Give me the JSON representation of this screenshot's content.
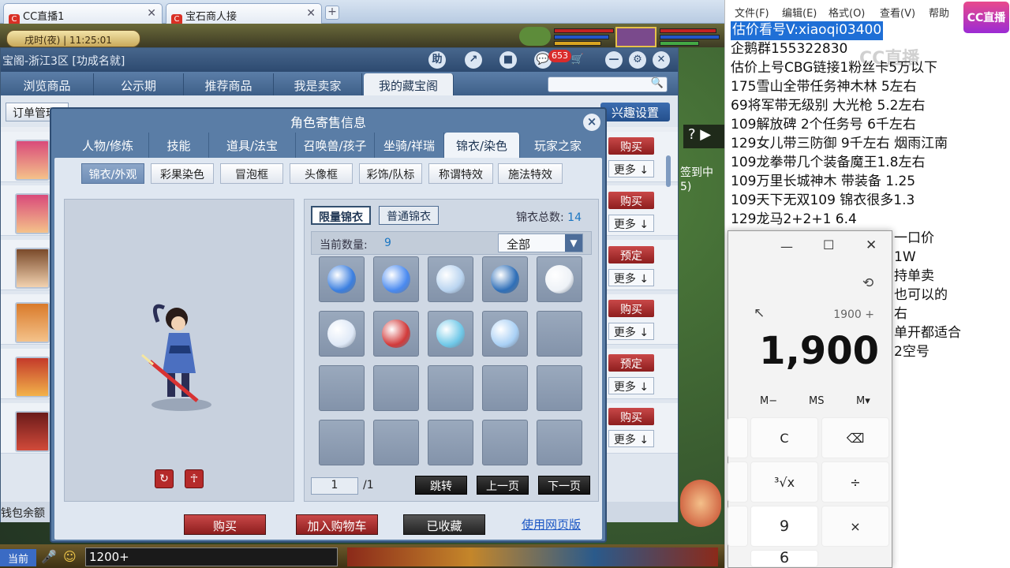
{
  "browser": {
    "tabs": [
      {
        "icon": "cc",
        "label": "CC直播1"
      },
      {
        "icon": "cc",
        "label": "宝石商人接"
      }
    ],
    "new_tab": "+"
  },
  "game": {
    "clock": "戌时(夜) | 11:25:01",
    "window": {
      "title": "宝阁-浙江3区 [功成名就]",
      "notify_count": "653",
      "header_buttons": [
        "助",
        "↗",
        "■",
        "💬",
        "🛒",
        "—",
        "⚙",
        "✕"
      ],
      "tabs": [
        "浏览商品",
        "公示期",
        "推荐商品",
        "我是卖家",
        "我的藏宝阁"
      ],
      "active_tab": 4,
      "sub_left": "订单管理",
      "sub_right": "兴趣设置",
      "side_text_1": "签到中",
      "side_text_2": "5)",
      "row_actions": [
        {
          "primary": "购买",
          "secondary": "更多"
        },
        {
          "primary": "购买",
          "secondary": "更多"
        },
        {
          "primary": "预定",
          "secondary": "更多"
        },
        {
          "primary": "购买",
          "secondary": "更多"
        },
        {
          "primary": "预定",
          "secondary": "更多"
        },
        {
          "primary": "购买",
          "secondary": "更多"
        }
      ],
      "wallet_label": "钱包余额"
    },
    "dialog": {
      "title": "角色寄售信息",
      "close": "×",
      "tabs": [
        "人物/修炼",
        "技能",
        "道具/法宝",
        "召唤兽/孩子",
        "坐骑/祥瑞",
        "锦衣/染色",
        "玩家之家"
      ],
      "active_tab": 5,
      "sub_tabs": [
        "锦衣/外观",
        "彩果染色",
        "冒泡框",
        "头像框",
        "彩饰/队标",
        "称谓特效",
        "施法特效"
      ],
      "active_sub_tab": 0,
      "list_tabs": [
        "限量锦衣",
        "普通锦衣"
      ],
      "active_list_tab": 0,
      "total_label": "锦衣总数:",
      "total_value": "14",
      "count_label": "当前数量:",
      "count_value": "9",
      "filter_value": "全部",
      "items": [
        "blue-swirl",
        "blue-wave",
        "silver-swirl",
        "blue-robe",
        "white-robe",
        "white-dress",
        "red-hair",
        "ice-beast",
        "crystal-wing"
      ],
      "page_current": "1",
      "page_total": "/1",
      "jump": "跳转",
      "prev": "上一页",
      "next": "下一页",
      "buy": "购买",
      "add_cart": "加入购物车",
      "favorited": "已收藏",
      "web_version": "使用网页版"
    },
    "hud": {
      "current": "当前",
      "input": "1200+"
    }
  },
  "notepad": {
    "menu": [
      "文件(F)",
      "编辑(E)",
      "格式(O)",
      "查看(V)",
      "帮助"
    ],
    "lines": [
      "估价看号V:xiaoqi03400",
      "企鹅群155322830",
      "估价上号CBG链接1",
      "175雪山全带任务神木林 5左右",
      "69将军带无级别 大光枪 5.2左右",
      "109解放碑 2个任务号 6千左右",
      "129女儿带三防御 9千左右 烟雨江南",
      "109龙拳带几个装备魔王1.8左右",
      "109万里长城神木 带装备  1.25",
      "109天下无双109  锦衣很多1.3",
      "129龙马2+2+1  6.4"
    ],
    "line3_tail": "粉丝卡5万以下",
    "right_fragments": [
      "一口价",
      "1W",
      "持单卖",
      "也可以的",
      "右",
      "单开都适合",
      "2空号"
    ]
  },
  "calculator": {
    "expression": "1900 +",
    "display": "1,900",
    "memory": [
      "M−",
      "MS",
      "M▾"
    ],
    "keys": [
      "C",
      "⌫",
      "³√x",
      "÷",
      "9",
      "×",
      "6"
    ]
  },
  "watermark": "CC直播",
  "logo_text": "CC直播"
}
